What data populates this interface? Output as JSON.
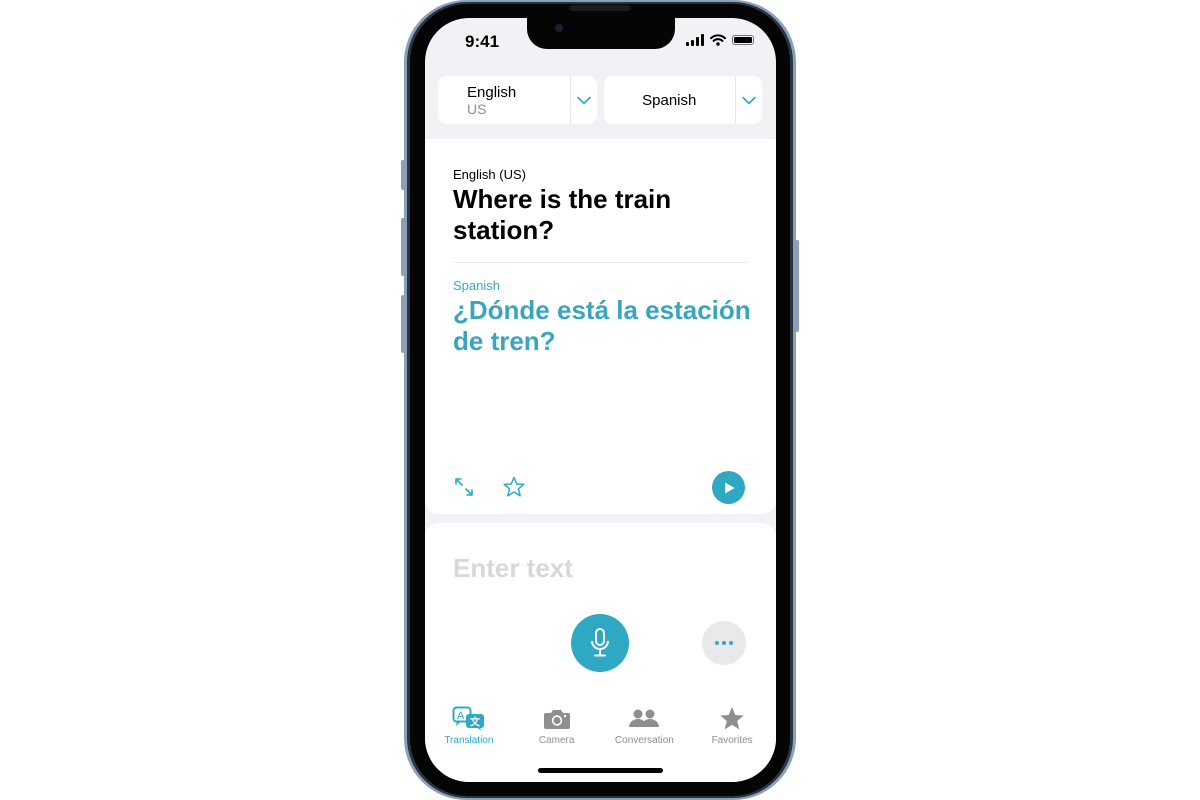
{
  "status_bar": {
    "time": "9:41"
  },
  "language_selector": {
    "source": {
      "name": "English",
      "region": "US"
    },
    "target": {
      "name": "Spanish"
    }
  },
  "translation": {
    "source_label": "English (US)",
    "source_text": "Where is the train station?",
    "target_label": "Spanish",
    "target_text": "¿Dónde está la estación de tren?"
  },
  "input": {
    "placeholder": "Enter text"
  },
  "tabs": [
    {
      "label": "Translation",
      "icon": "translation-icon",
      "active": true
    },
    {
      "label": "Camera",
      "icon": "camera-icon",
      "active": false
    },
    {
      "label": "Conversation",
      "icon": "conversation-icon",
      "active": false
    },
    {
      "label": "Favorites",
      "icon": "star-icon",
      "active": false
    }
  ],
  "colors": {
    "accent": "#2fa8c4",
    "inactive": "#8e8e93",
    "background": "#f2f2f6"
  }
}
